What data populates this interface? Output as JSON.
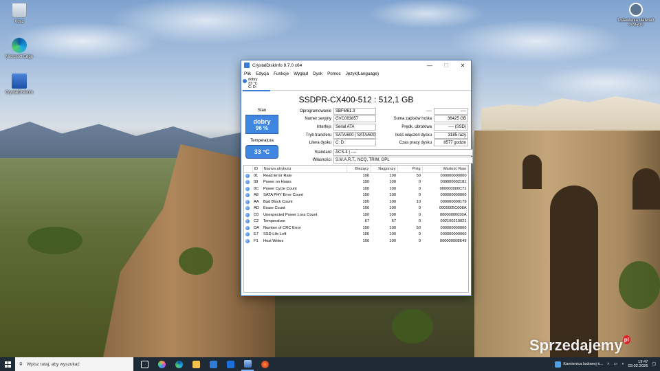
{
  "desktop": {
    "icons": [
      {
        "label": "Kosz"
      },
      {
        "label": "Microsoft Edge"
      },
      {
        "label": "CrystalDiskInfo"
      }
    ],
    "top_right_icon_label": "Ustawienia ułatwień dostępu"
  },
  "window": {
    "title": "CrystalDiskInfo 9.7.0 x64",
    "controls": {
      "minimize": "—",
      "maximize": "☐",
      "close": "✕"
    },
    "menu": [
      "Plik",
      "Edycja",
      "Funkcje",
      "Wygląd",
      "Dysk",
      "Pomoc",
      "Język(Language)"
    ],
    "drive_tab": {
      "status": "dobry",
      "temp": "33 °C",
      "letter": "C: D:"
    },
    "drive_title": "SSDPR-CX400-512 : 512,1 GB",
    "status_label": "Stan",
    "health": {
      "status": "dobry",
      "percent": "96 %"
    },
    "temp_label": "Temperatura",
    "temp_value": "33 °C",
    "info_mid": [
      {
        "label": "Oprogramowanie",
        "value": "SBFM61.3"
      },
      {
        "label": "Numer seryjny",
        "value": "GVC083857"
      },
      {
        "label": "Interfejs",
        "value": "Serial ATA"
      },
      {
        "label": "Tryb transferu",
        "value": "SATA/600 | SATA/600"
      },
      {
        "label": "Litera dysku",
        "value": "C: D:"
      }
    ],
    "info_right": [
      {
        "label": "----",
        "value": "----"
      },
      {
        "label": "Suma zapisów hosta",
        "value": "36425 GB"
      },
      {
        "label": "Prędk. obrotowa",
        "value": "---- (SSD)"
      },
      {
        "label": "Ilość włączeń dysku",
        "value": "3185 razy"
      },
      {
        "label": "Czas pracy dysku",
        "value": "8577 godzin"
      }
    ],
    "standard": {
      "label": "Standard",
      "value": "ACS-4 | ----"
    },
    "features": {
      "label": "Własności",
      "value": "S.M.A.R.T., NCQ, TRIM, GPL"
    },
    "smart": {
      "columns": [
        "ID",
        "Nazwa atrybutu",
        "Bieżący",
        "Najgorszy",
        "Próg",
        "Wartość Raw"
      ],
      "rows": [
        [
          "01",
          "Read Error Rate",
          "100",
          "100",
          "50",
          "000000000000"
        ],
        [
          "09",
          "Power on Hours",
          "100",
          "100",
          "0",
          "000000002181"
        ],
        [
          "0C",
          "Power Cycle Count",
          "100",
          "100",
          "0",
          "000000000C71"
        ],
        [
          "A8",
          "SATA PHY Error Count",
          "100",
          "100",
          "0",
          "000000000000"
        ],
        [
          "AA",
          "Bad Block Count",
          "100",
          "100",
          "10",
          "000000000179"
        ],
        [
          "AD",
          "Erase Count",
          "100",
          "100",
          "0",
          "0000005C008A"
        ],
        [
          "C0",
          "Unexpected Power Loss Count",
          "100",
          "100",
          "0",
          "00000000030A"
        ],
        [
          "C2",
          "Temperature",
          "67",
          "67",
          "0",
          "002100210021"
        ],
        [
          "DA",
          "Number of CRC Error",
          "100",
          "100",
          "50",
          "000000000000"
        ],
        [
          "E7",
          "SSD Life Left",
          "100",
          "100",
          "0",
          "000000000060"
        ],
        [
          "F1",
          "Host Writes",
          "100",
          "100",
          "0",
          "000000008E49"
        ]
      ]
    }
  },
  "taskbar": {
    "search_placeholder": "Wpisz tutaj, aby wyszukać",
    "news": "Kamienica lodowej ś...",
    "time": "19:47",
    "date": "03.02.2026"
  },
  "watermark": {
    "text": "Sprzedajemy",
    "badge": "pl"
  },
  "colors": {
    "accent": "#3f86e0",
    "taskbar": "#1e2a36"
  }
}
